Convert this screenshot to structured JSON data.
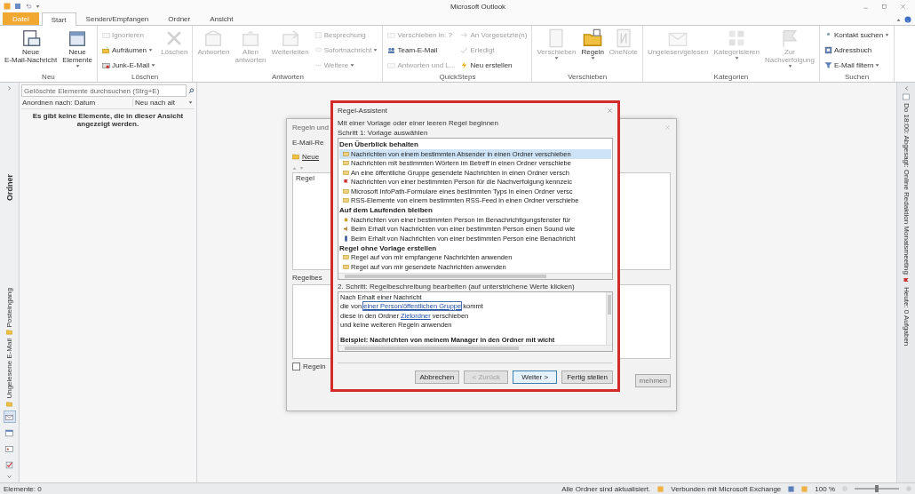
{
  "window": {
    "title": "Microsoft Outlook"
  },
  "ribbon_tabs": [
    {
      "label": "Datei",
      "kind": "file",
      "selected": false
    },
    {
      "label": "Start",
      "kind": "tab",
      "selected": true
    },
    {
      "label": "Senden/Empfangen",
      "kind": "tab",
      "selected": false
    },
    {
      "label": "Ordner",
      "kind": "tab",
      "selected": false
    },
    {
      "label": "Ansicht",
      "kind": "tab",
      "selected": false
    }
  ],
  "ribbon_groups": [
    {
      "label": "Neu",
      "columns": [
        [
          {
            "kind": "large",
            "lines": [
              "Neue",
              "E-Mail-Nachricht"
            ],
            "disabled": false,
            "dropdown": false
          }
        ],
        [
          {
            "kind": "large",
            "lines": [
              "Neue",
              "Elemente"
            ],
            "disabled": false,
            "dropdown": true
          }
        ]
      ]
    },
    {
      "label": "Löschen",
      "columns": [
        [
          {
            "kind": "small",
            "lines": [
              "Ignorieren"
            ],
            "disabled": true,
            "dropdown": false
          },
          {
            "kind": "small",
            "lines": [
              "Aufräumen"
            ],
            "disabled": false,
            "dropdown": true
          },
          {
            "kind": "small",
            "lines": [
              "Junk-E-Mail"
            ],
            "disabled": false,
            "dropdown": true
          }
        ],
        [
          {
            "kind": "large",
            "lines": [
              "Löschen"
            ],
            "disabled": true,
            "dropdown": false
          }
        ]
      ]
    },
    {
      "label": "Antworten",
      "columns": [
        [
          {
            "kind": "large",
            "lines": [
              "Antworten"
            ],
            "disabled": true,
            "dropdown": false
          }
        ],
        [
          {
            "kind": "large",
            "lines": [
              "Allen",
              "antworten"
            ],
            "disabled": true,
            "dropdown": false
          }
        ],
        [
          {
            "kind": "large",
            "lines": [
              "Weiterleiten"
            ],
            "disabled": true,
            "dropdown": false
          }
        ],
        [
          {
            "kind": "small",
            "lines": [
              "Besprechung"
            ],
            "disabled": true,
            "dropdown": false
          },
          {
            "kind": "small",
            "lines": [
              "Sofortnachricht"
            ],
            "disabled": true,
            "dropdown": true
          },
          {
            "kind": "small",
            "lines": [
              "Weitere"
            ],
            "disabled": true,
            "dropdown": true
          }
        ]
      ]
    },
    {
      "label": "QuickSteps",
      "columns": [
        [
          {
            "kind": "small",
            "lines": [
              "Verschieben in: ?"
            ],
            "disabled": true,
            "dropdown": false
          },
          {
            "kind": "small",
            "lines": [
              "Team-E-Mail"
            ],
            "disabled": false,
            "dropdown": false
          },
          {
            "kind": "small",
            "lines": [
              "Antworten und L..."
            ],
            "disabled": true,
            "dropdown": false
          }
        ],
        [
          {
            "kind": "small",
            "lines": [
              "An Vorgesetzte(n)"
            ],
            "disabled": true,
            "dropdown": false
          },
          {
            "kind": "small",
            "lines": [
              "Erledigt"
            ],
            "disabled": true,
            "dropdown": false
          },
          {
            "kind": "small",
            "lines": [
              "Neu erstellen"
            ],
            "disabled": false,
            "dropdown": false
          }
        ]
      ]
    },
    {
      "label": "Verschieben",
      "columns": [
        [
          {
            "kind": "large",
            "lines": [
              "Verschieben"
            ],
            "disabled": true,
            "dropdown": true
          }
        ],
        [
          {
            "kind": "large",
            "lines": [
              "Regeln"
            ],
            "disabled": false,
            "dropdown": true
          }
        ],
        [
          {
            "kind": "large",
            "lines": [
              "OneNote"
            ],
            "disabled": true,
            "dropdown": false
          }
        ]
      ]
    },
    {
      "label": "Kategorien",
      "columns": [
        [
          {
            "kind": "large",
            "lines": [
              "Ungelesen/gelesen"
            ],
            "disabled": true,
            "dropdown": false
          }
        ],
        [
          {
            "kind": "large",
            "lines": [
              "Kategorisieren"
            ],
            "disabled": true,
            "dropdown": true
          }
        ],
        [
          {
            "kind": "large",
            "lines": [
              "Zur",
              "Nachverfolgung"
            ],
            "disabled": true,
            "dropdown": true
          }
        ]
      ]
    },
    {
      "label": "Suchen",
      "columns": [
        [
          {
            "kind": "small",
            "lines": [
              "Kontakt suchen"
            ],
            "disabled": false,
            "dropdown": true
          },
          {
            "kind": "small",
            "lines": [
              "Adressbuch"
            ],
            "disabled": false,
            "dropdown": false
          },
          {
            "kind": "small",
            "lines": [
              "E-Mail filtern"
            ],
            "disabled": false,
            "dropdown": true
          }
        ]
      ]
    }
  ],
  "navigation": {
    "title": "Ordner",
    "favorites": [
      {
        "label": "Posteingang"
      },
      {
        "label": "Ungelesene E-Mail"
      }
    ],
    "modules": [
      {
        "selected": true
      },
      {
        "selected": false
      },
      {
        "selected": false
      },
      {
        "selected": false
      }
    ]
  },
  "message_list": {
    "search": {
      "placeholder": "Gelöschte Elemente durchsuchen (Strg+E)"
    },
    "arrange_by": "Anordnen nach: Datum",
    "sort_order": "Neu nach alt",
    "empty_message": "Es gibt keine Elemente, die in dieser Ansicht angezeigt werden."
  },
  "rules_dialog": {
    "title": "Regeln und",
    "tab": "E-Mail-Re",
    "new_button": "Neue",
    "column": "Regel",
    "description_label": "Regelbes",
    "checkbox": {
      "label": "Regeln",
      "checked": false
    },
    "apply_button": "rnehmen"
  },
  "rules_wizard": {
    "title": "Regel-Assistent",
    "intro": "Mit einer Vorlage oder einer leeren Regel beginnen",
    "step1": "Schritt 1: Vorlage auswählen",
    "template_groups": [
      {
        "title": "Den Überblick behalten",
        "templates": [
          {
            "text": "Nachrichten von einem bestimmten Absender in einen Ordner verschieben",
            "selected": true
          },
          {
            "text": "Nachrichten mit bestimmten Wörtern im Betreff in einen Ordner verschiebe",
            "selected": false
          },
          {
            "text": "An eine öffentliche Gruppe gesendete Nachrichten in einen Ordner versch",
            "selected": false
          },
          {
            "text": "Nachrichten von einer bestimmten Person für die Nachverfolgung kennzeic",
            "selected": false
          },
          {
            "text": "Microsoft InfoPath-Formulare eines bestimmten Typs in einen Ordner versc",
            "selected": false
          },
          {
            "text": "RSS-Elemente von einem bestimmten RSS-Feed in einen Ordner verschiebe",
            "selected": false
          }
        ]
      },
      {
        "title": "Auf dem Laufenden bleiben",
        "templates": [
          {
            "text": "Nachrichten von einer bestimmten Person im Benachrichtigungsfenster für",
            "selected": false
          },
          {
            "text": "Beim Erhalt von Nachrichten von einer bestimmten Person einen Sound wie",
            "selected": false
          },
          {
            "text": "Beim Erhalt von Nachrichten von einer bestimmten Person eine Benachricht",
            "selected": false
          }
        ]
      },
      {
        "title": "Regel ohne Vorlage erstellen",
        "templates": [
          {
            "text": "Regel auf von mir empfangene Nachrichten anwenden",
            "selected": false
          },
          {
            "text": "Regel auf von mir gesendete Nachrichten anwenden",
            "selected": false
          }
        ]
      }
    ],
    "step2": "2. Schritt: Regelbeschreibung bearbeiten (auf unterstrichene Werte klicken)",
    "description": [
      {
        "parts": [
          {
            "text": "Nach Erhalt einer Nachricht",
            "link": false
          }
        ]
      },
      {
        "parts": [
          {
            "text": "die von ",
            "link": false
          },
          {
            "text": "einer Person/öffentlichen Gruppe",
            "link": true
          },
          {
            "text": " kommt",
            "link": false
          }
        ]
      },
      {
        "parts": [
          {
            "text": "diese in den Ordner ",
            "link": false
          },
          {
            "text": "Zielordner",
            "link": true
          },
          {
            "text": " verschieben",
            "link": false
          }
        ]
      },
      {
        "parts": [
          {
            "text": " und keine weiteren Regeln anwenden",
            "link": false
          }
        ]
      }
    ],
    "example": "Beispiel: Nachrichten von meinem Manager in den Ordner mit wicht",
    "buttons": [
      {
        "label": "Abbrechen",
        "disabled": false,
        "default": false
      },
      {
        "label": "< Zurück",
        "disabled": true,
        "default": false
      },
      {
        "label": "Weiter >",
        "disabled": false,
        "default": true
      },
      {
        "label": "Fertig stellen",
        "disabled": false,
        "default": false
      }
    ]
  },
  "todo_bar": {
    "appointment": "Do 18:00: Abgesagt: Online Redaktion Monatsmeeting",
    "tasks": "Heute: 0 Aufgaben"
  },
  "status_bar": {
    "items": "Elemente: 0",
    "sync": "Alle Ordner sind aktualisiert.",
    "connection": "Verbunden mit Microsoft Exchange",
    "zoom": "100 %",
    "zoom_slider": {
      "level": 0.5
    }
  }
}
